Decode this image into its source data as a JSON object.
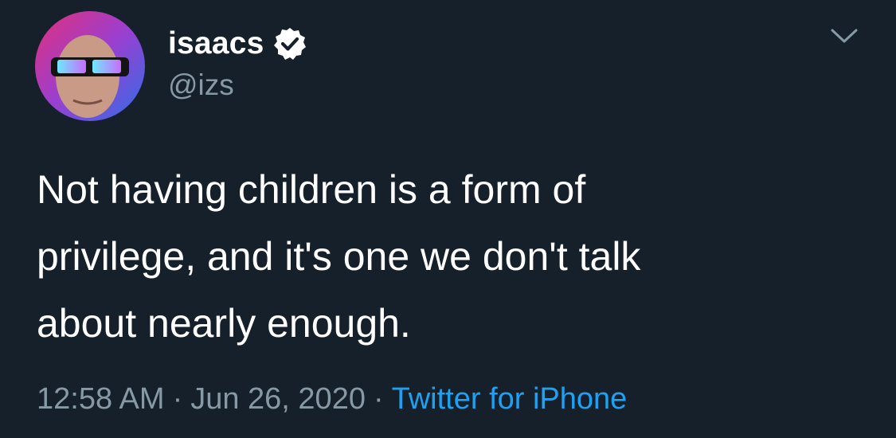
{
  "tweet": {
    "author": {
      "display_name": "isaacs",
      "handle": "@izs",
      "verified": true,
      "avatar_icon": "user-avatar"
    },
    "text": "Not having children is a form of\nprivilege, and it's one we don't talk\nabout nearly enough.",
    "time": "12:58 AM",
    "date": "Jun 26, 2020",
    "separator": "·",
    "source": "Twitter for iPhone"
  },
  "icons": {
    "verified": "verified-badge-icon",
    "menu": "chevron-down-icon"
  },
  "colors": {
    "background": "#15202b",
    "text_primary": "#ffffff",
    "text_secondary": "#8899a6",
    "link": "#1da1f2"
  }
}
